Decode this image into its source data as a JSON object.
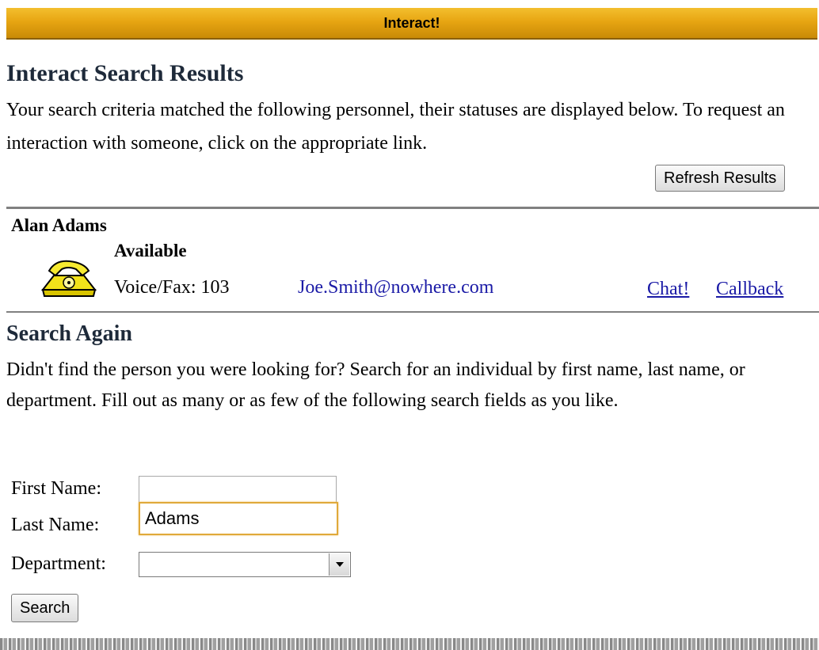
{
  "header": {
    "title": "Interact!"
  },
  "results": {
    "title": "Interact Search Results",
    "intro": "Your search criteria matched the following personnel, their statuses are displayed below. To request an interaction with someone, click on the appropriate link.",
    "refresh_label": "Refresh Results",
    "person": {
      "name": "Alan Adams",
      "status": "Available",
      "voice_fax": "Voice/Fax: 103",
      "email": "Joe.Smith@nowhere.com",
      "chat_link": "Chat!",
      "callback_link": "Callback",
      "icon": "phone-icon"
    }
  },
  "search_again": {
    "title": "Search Again",
    "text": "Didn't find the person you were looking for? Search for an individual by first name, last name, or department. Fill out as many or as few of the following search fields as you like.",
    "first_name_label": "First Name:",
    "first_name_value": "",
    "last_name_label": "Last Name:",
    "last_name_value": "Adams",
    "department_label": "Department:",
    "department_value": "",
    "search_label": "Search"
  },
  "colors": {
    "header_bar": "#e7a512",
    "link": "#1a1aa6",
    "focus_border": "#e0a93a"
  }
}
